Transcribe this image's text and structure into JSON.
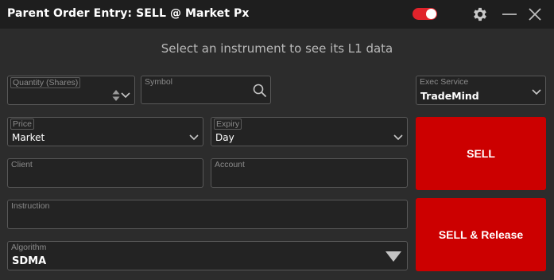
{
  "window": {
    "title": "Parent Order Entry: SELL @ Market Px",
    "toggle_on": true,
    "accent": "#e0232b"
  },
  "hint": "Select an instrument to see its L1 data",
  "fields": {
    "quantity": {
      "label": "Quantity (Shares)",
      "value": ""
    },
    "symbol": {
      "label": "Symbol",
      "value": ""
    },
    "exec_service": {
      "label": "Exec Service",
      "value": "TradeMind"
    },
    "price": {
      "label": "Price",
      "value": "Market"
    },
    "expiry": {
      "label": "Expiry",
      "value": "Day"
    },
    "client": {
      "label": "Client",
      "value": ""
    },
    "account": {
      "label": "Account",
      "value": ""
    },
    "instruction": {
      "label": "Instruction",
      "value": ""
    },
    "algorithm": {
      "label": "Algorithm",
      "value": "SDMA"
    }
  },
  "buttons": {
    "sell": "SELL",
    "sell_release": "SELL & Release",
    "color": "#cc0000"
  },
  "icons": [
    "toggle-switch",
    "gear-icon",
    "minimize-icon",
    "close-icon",
    "search-icon",
    "spinner-icon",
    "chevron-down-icon",
    "triangle-down-icon"
  ]
}
